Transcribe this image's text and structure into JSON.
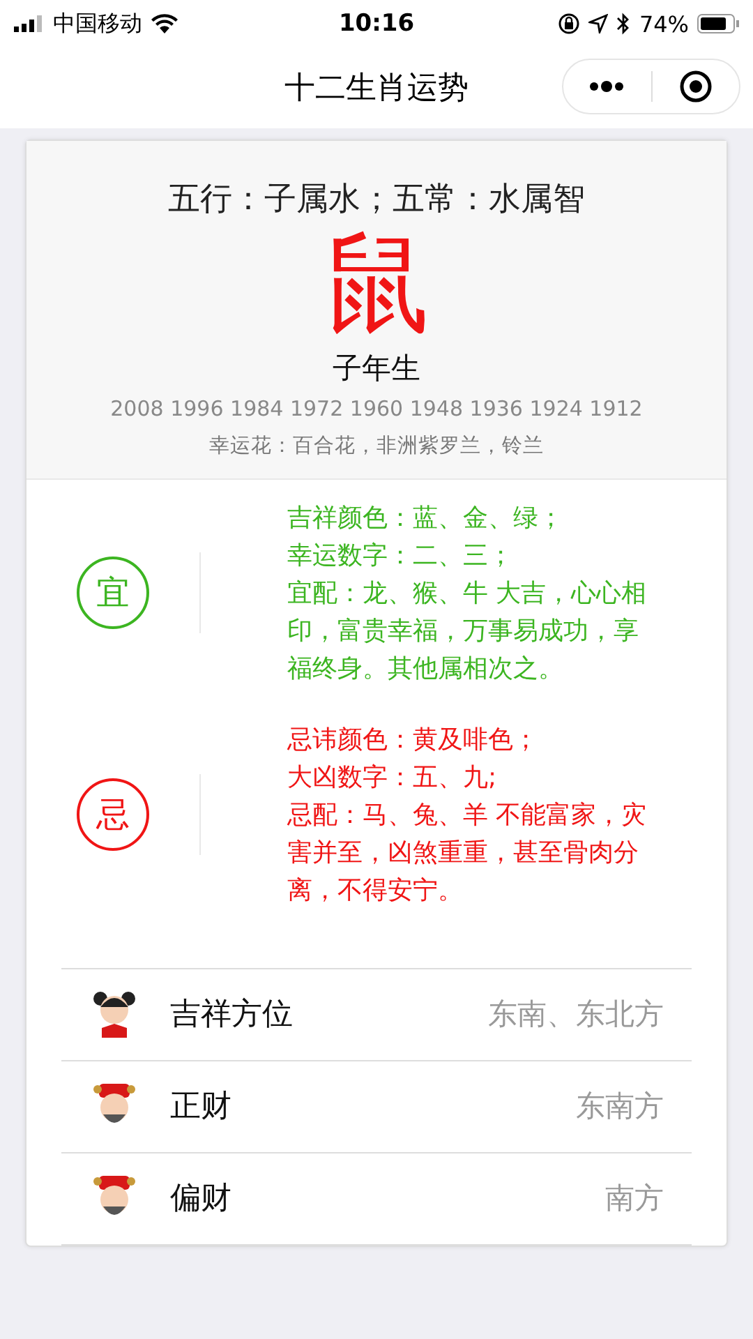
{
  "status_bar": {
    "carrier": "中国移动",
    "time": "10:16",
    "battery": "74%"
  },
  "nav": {
    "title": "十二生肖运势"
  },
  "header": {
    "elements": "五行：子属水；五常：水属智",
    "animal": "鼠",
    "birth": "子年生",
    "years": "2008 1996 1984 1972 1960 1948 1936 1924 1912",
    "flowers": "幸运花：百合花，非洲紫罗兰，铃兰"
  },
  "advice": [
    {
      "kind": "good",
      "badge": "宜",
      "lines": [
        "吉祥颜色：蓝、金、绿；",
        "幸运数字：二、三；",
        "宜配：龙、猴、牛 大吉，心心相印，富贵幸福，万事易成功，享福终身。其他属相次之。"
      ]
    },
    {
      "kind": "bad",
      "badge": "忌",
      "lines": [
        "忌讳颜色：黄及啡色；",
        "大凶数字：五、九;",
        "忌配：马、兔、羊 不能富家，灾害并至，凶煞重重，甚至骨肉分离，不得安宁。"
      ]
    }
  ],
  "rows": [
    {
      "kind": "girl",
      "label": "吉祥方位",
      "value": "东南、东北方"
    },
    {
      "kind": "god",
      "label": "正财",
      "value": "东南方"
    },
    {
      "kind": "god",
      "label": "偏财",
      "value": "南方"
    }
  ]
}
